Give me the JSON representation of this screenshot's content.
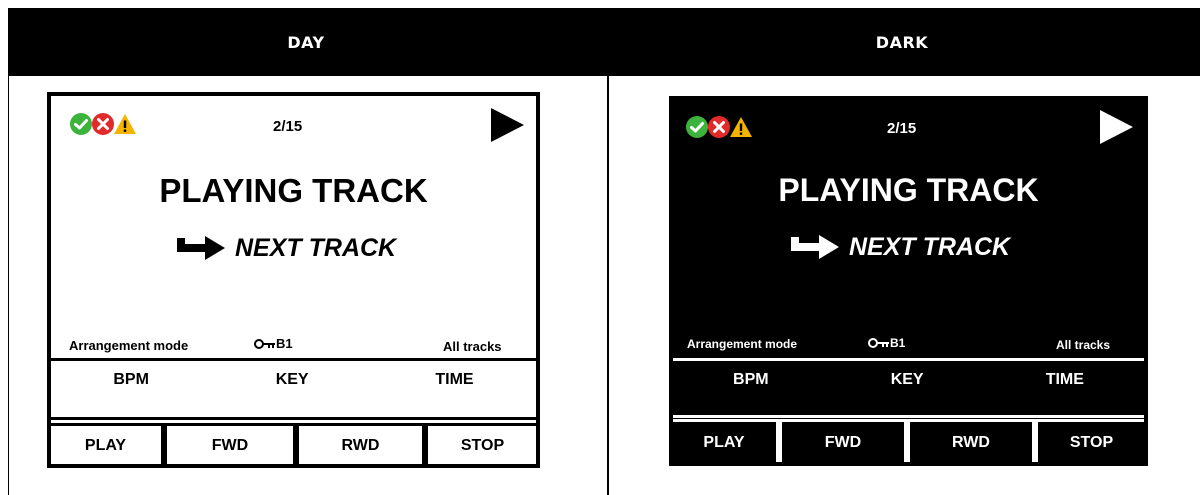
{
  "header": {
    "day_label": "DAY",
    "dark_label": "DARK"
  },
  "screen": {
    "counter": "2/15",
    "playing_track": "PLAYING TRACK",
    "next_track": "NEXT TRACK",
    "mode_label": "Arrangement mode",
    "key_value": "B1",
    "tracks_filter": "All tracks",
    "meta": {
      "bpm": "BPM",
      "key": "KEY",
      "time": "TIME"
    },
    "buttons": {
      "play": "PLAY",
      "fwd": "FWD",
      "rwd": "RWD",
      "stop": "STOP"
    },
    "status_icons": [
      "check-circle-icon",
      "error-circle-icon",
      "warning-triangle-icon"
    ]
  },
  "colors": {
    "ok_green": "#3cb43c",
    "error_red": "#e22a2a",
    "warning_yellow": "#f5b400",
    "day_bg": "#ffffff",
    "dark_bg": "#000000"
  }
}
